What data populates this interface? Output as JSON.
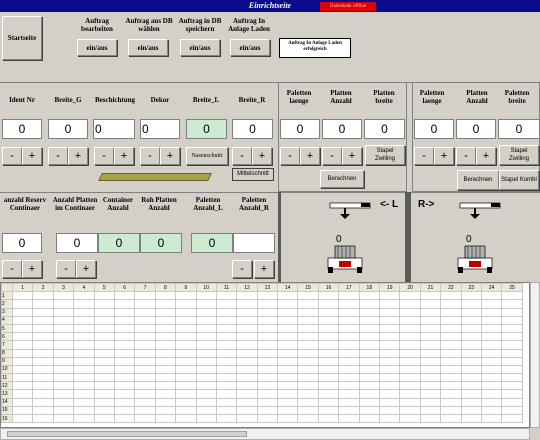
{
  "window": {
    "title": "Einrichtseite",
    "status_badge": "Datenbank offline"
  },
  "toolbar": {
    "start_button": "Startseite",
    "groups": [
      {
        "label": "Auftrag bearbeiten",
        "button": "ein/aus"
      },
      {
        "label": "Auftrag aus DB wählen",
        "button": "ein/aus"
      },
      {
        "label": "Auftrag in DB speichern",
        "button": "ein/aus"
      },
      {
        "label": "Auftrag In Anlage Laden",
        "button": "ein/aus"
      }
    ],
    "message": "Auftrag In Anlage Laden erfolgreich"
  },
  "row1": {
    "fields": [
      {
        "label": "Ident Nr",
        "value": "0"
      },
      {
        "label": "Breite_G",
        "value": "0"
      },
      {
        "label": "Beschichtung",
        "value": "0"
      },
      {
        "label": "Dekor",
        "value": "0"
      },
      {
        "label": "Breite_L",
        "value": "0"
      },
      {
        "label": "Breite_R",
        "value": "0"
      }
    ],
    "naesenschnitt": "Nasenschnitt",
    "mittelschnitt": "Mittelschnitt",
    "left_stack": {
      "labels": [
        "Paletten laenge",
        "Platten Anzahl",
        "Platten breite"
      ],
      "values": [
        "0",
        "0",
        "0"
      ],
      "stapel": "Stapel Zwilling",
      "berechnen": "Berechnen"
    },
    "right_stack": {
      "labels": [
        "Paletten laenge",
        "Platten Anzahl",
        "Paletten breite"
      ],
      "values": [
        "0",
        "0",
        "0"
      ],
      "stapel1": "Stapel Zwilling",
      "berechnen": "Berechnen",
      "stapel2": "Stapel Kombi"
    }
  },
  "row2": {
    "fields": [
      {
        "label": "anzahl Reserv Continaer",
        "value": "0"
      },
      {
        "label": "Anzahl Platten im Continaer",
        "value": "0"
      },
      {
        "label": "Container Anzahl",
        "value": "0"
      },
      {
        "label": "Roh Platten Anzahl",
        "value": "0"
      },
      {
        "label": "Paletten Anzahl_L",
        "value": "0"
      },
      {
        "label": "Paletten Anzahl_R",
        "value": ""
      }
    ],
    "left_dir": "<- L",
    "right_dir": "R->",
    "left_count": "0",
    "right_count": "0"
  },
  "grid": {
    "columns": [
      "1",
      "2",
      "3",
      "4",
      "5",
      "6",
      "7",
      "8",
      "9",
      "10",
      "11",
      "12",
      "13",
      "14",
      "15",
      "16",
      "17",
      "18",
      "19",
      "20",
      "21",
      "22",
      "23",
      "24",
      "25"
    ],
    "rows": [
      "1",
      "2",
      "3",
      "4",
      "5",
      "6",
      "7",
      "8",
      "9",
      "10",
      "11",
      "12",
      "13",
      "14",
      "15",
      "16"
    ]
  },
  "controls": {
    "minus": "-",
    "plus": "+"
  }
}
